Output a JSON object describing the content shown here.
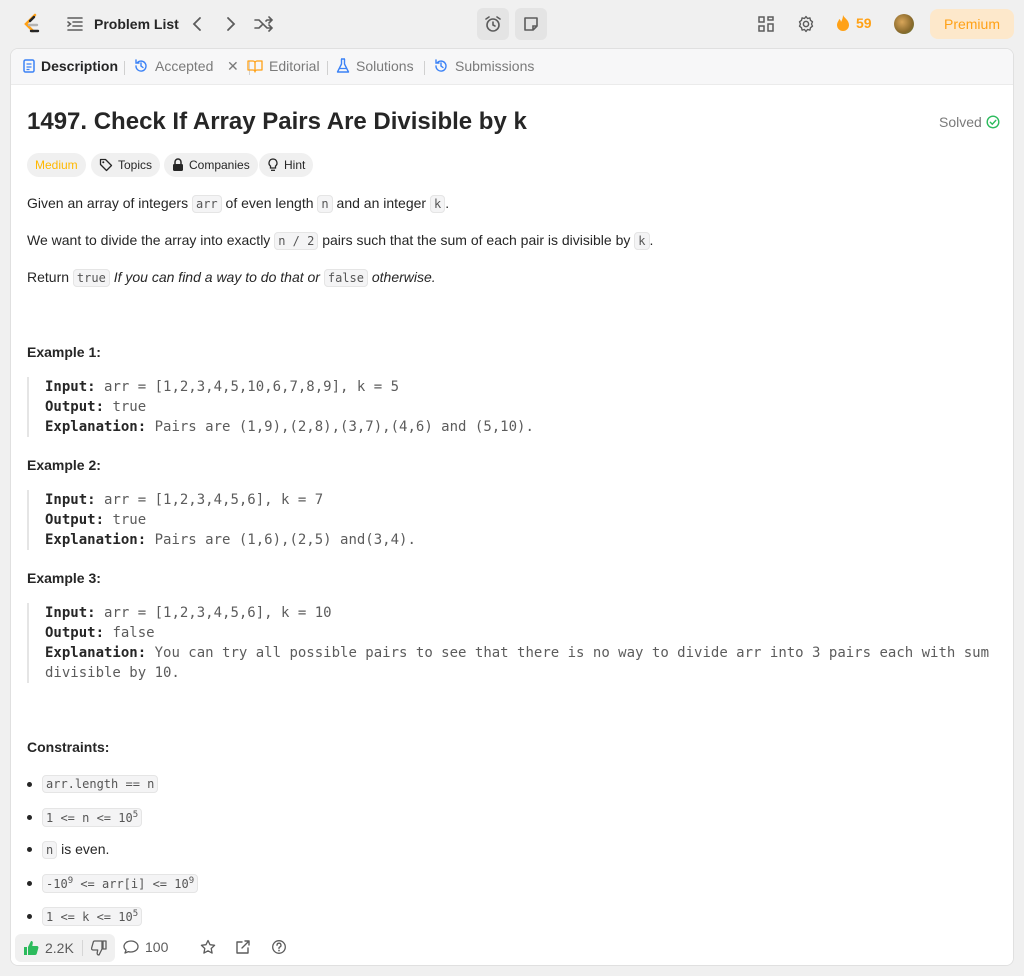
{
  "topbar": {
    "problem_list_label": "Problem List",
    "streak_count": "59",
    "premium_label": "Premium"
  },
  "tabs": [
    {
      "label": "Description",
      "icon": "description-icon"
    },
    {
      "label": "Accepted",
      "icon": "history-icon"
    },
    {
      "label": "Editorial",
      "icon": "book-icon"
    },
    {
      "label": "Solutions",
      "icon": "flask-icon"
    },
    {
      "label": "Submissions",
      "icon": "history-icon"
    }
  ],
  "problem": {
    "title": "1497. Check If Array Pairs Are Divisible by k",
    "status": "Solved",
    "difficulty": "Medium",
    "chips": {
      "topics": "Topics",
      "companies": "Companies",
      "hint": "Hint"
    },
    "p1": {
      "a": "Given an array of integers ",
      "code1": "arr",
      "b": " of even length ",
      "code2": "n",
      "c": " and an integer ",
      "code3": "k",
      "d": "."
    },
    "p2": {
      "a": "We want to divide the array into exactly ",
      "code1": "n / 2",
      "b": " pairs such that the sum of each pair is divisible by ",
      "code2": "k",
      "c": "."
    },
    "p3": {
      "a": "Return ",
      "code1": "true",
      "b": "If you can find a way to do that or ",
      "code2": "false",
      "c": "otherwise."
    }
  },
  "examples": [
    {
      "title": "Example 1:",
      "input_label": "Input:",
      "input": "arr = [1,2,3,4,5,10,6,7,8,9], k = 5",
      "output_label": "Output:",
      "output": "true",
      "expl_label": "Explanation:",
      "explanation": "Pairs are (1,9),(2,8),(3,7),(4,6) and (5,10)."
    },
    {
      "title": "Example 2:",
      "input_label": "Input:",
      "input": "arr = [1,2,3,4,5,6], k = 7",
      "output_label": "Output:",
      "output": "true",
      "expl_label": "Explanation:",
      "explanation": "Pairs are (1,6),(2,5) and(3,4)."
    },
    {
      "title": "Example 3:",
      "input_label": "Input:",
      "input": "arr = [1,2,3,4,5,6], k = 10",
      "output_label": "Output:",
      "output": "false",
      "expl_label": "Explanation:",
      "explanation": "You can try all possible pairs to see that there is no way to divide arr into 3 pairs each with sum",
      "explanation_2": "divisible by 10."
    }
  ],
  "constraints": {
    "title": "Constraints:",
    "c1": "arr.length == n",
    "c2": {
      "base": "1 <= n <= 10",
      "sup": "5"
    },
    "c3": {
      "code": "n",
      "text": " is even."
    },
    "c4": {
      "base1": "-10",
      "sup1": "9",
      "mid": " <= arr[i] <= 10",
      "sup2": "9"
    },
    "c5": {
      "base": "1 <= k <= 10",
      "sup": "5"
    }
  },
  "footer": {
    "likes": "2.2K",
    "comments": "100"
  },
  "colors": {
    "accent": "#ffa116",
    "solved": "#2cbb5d",
    "medium": "#ffb800",
    "like": "#2cbb5d"
  }
}
